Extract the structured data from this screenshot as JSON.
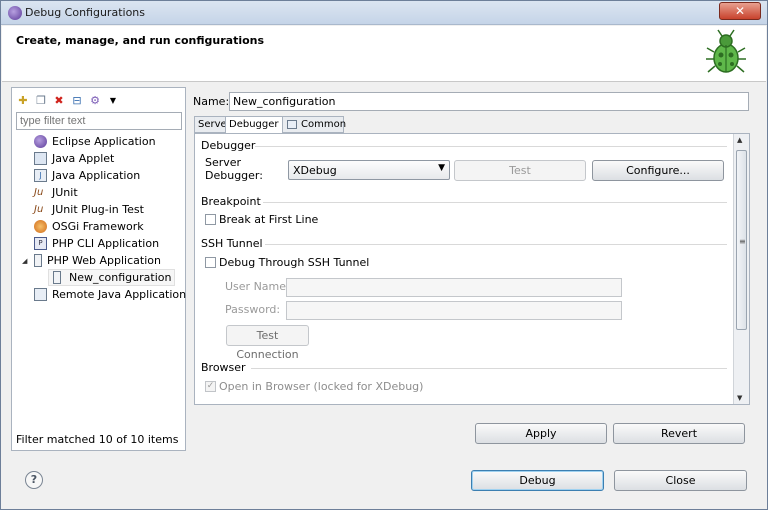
{
  "window": {
    "title": "Debug Configurations",
    "close_label": "✕"
  },
  "header": {
    "heading": "Create, manage, and run configurations"
  },
  "left": {
    "filter_placeholder": "type filter text",
    "tree": [
      {
        "label": "Eclipse Application",
        "icon": "eclipse-app-icon"
      },
      {
        "label": "Java Applet",
        "icon": "java-applet-icon"
      },
      {
        "label": "Java Application",
        "icon": "java-app-icon"
      },
      {
        "label": "JUnit",
        "icon": "junit-icon"
      },
      {
        "label": "JUnit Plug-in Test",
        "icon": "junit-plugin-icon"
      },
      {
        "label": "OSGi Framework",
        "icon": "osgi-icon"
      },
      {
        "label": "PHP CLI Application",
        "icon": "php-cli-icon"
      },
      {
        "label": "PHP Web Application",
        "icon": "php-web-icon",
        "expanded": true
      },
      {
        "label": "New_configuration",
        "icon": "config-file-icon",
        "selected": true
      },
      {
        "label": "Remote Java Application",
        "icon": "remote-java-icon"
      }
    ],
    "footer": "Filter matched 10 of 10 items"
  },
  "right": {
    "name_label": "Name:",
    "name_value": "New_configuration",
    "tabs": [
      "Server",
      "Debugger",
      "Common"
    ],
    "debugger_section": "Debugger",
    "server_debugger_label_1": "Server",
    "server_debugger_label_2": "Debugger:",
    "server_debugger_value": "XDebug",
    "test_button": "Test",
    "configure_button": "Configure...",
    "breakpoint_section": "Breakpoint",
    "break_first_line": "Break at First Line",
    "ssh_section": "SSH Tunnel",
    "debug_ssh": "Debug Through SSH Tunnel",
    "username_label": "User Name:",
    "password_label": "Password:",
    "test_connection": "Test Connection",
    "browser_section": "Browser",
    "open_browser": "Open in Browser (locked for XDebug)",
    "apply_button": "Apply",
    "revert_button": "Revert"
  },
  "footer": {
    "debug_button": "Debug",
    "close_button": "Close",
    "help_label": "?"
  }
}
